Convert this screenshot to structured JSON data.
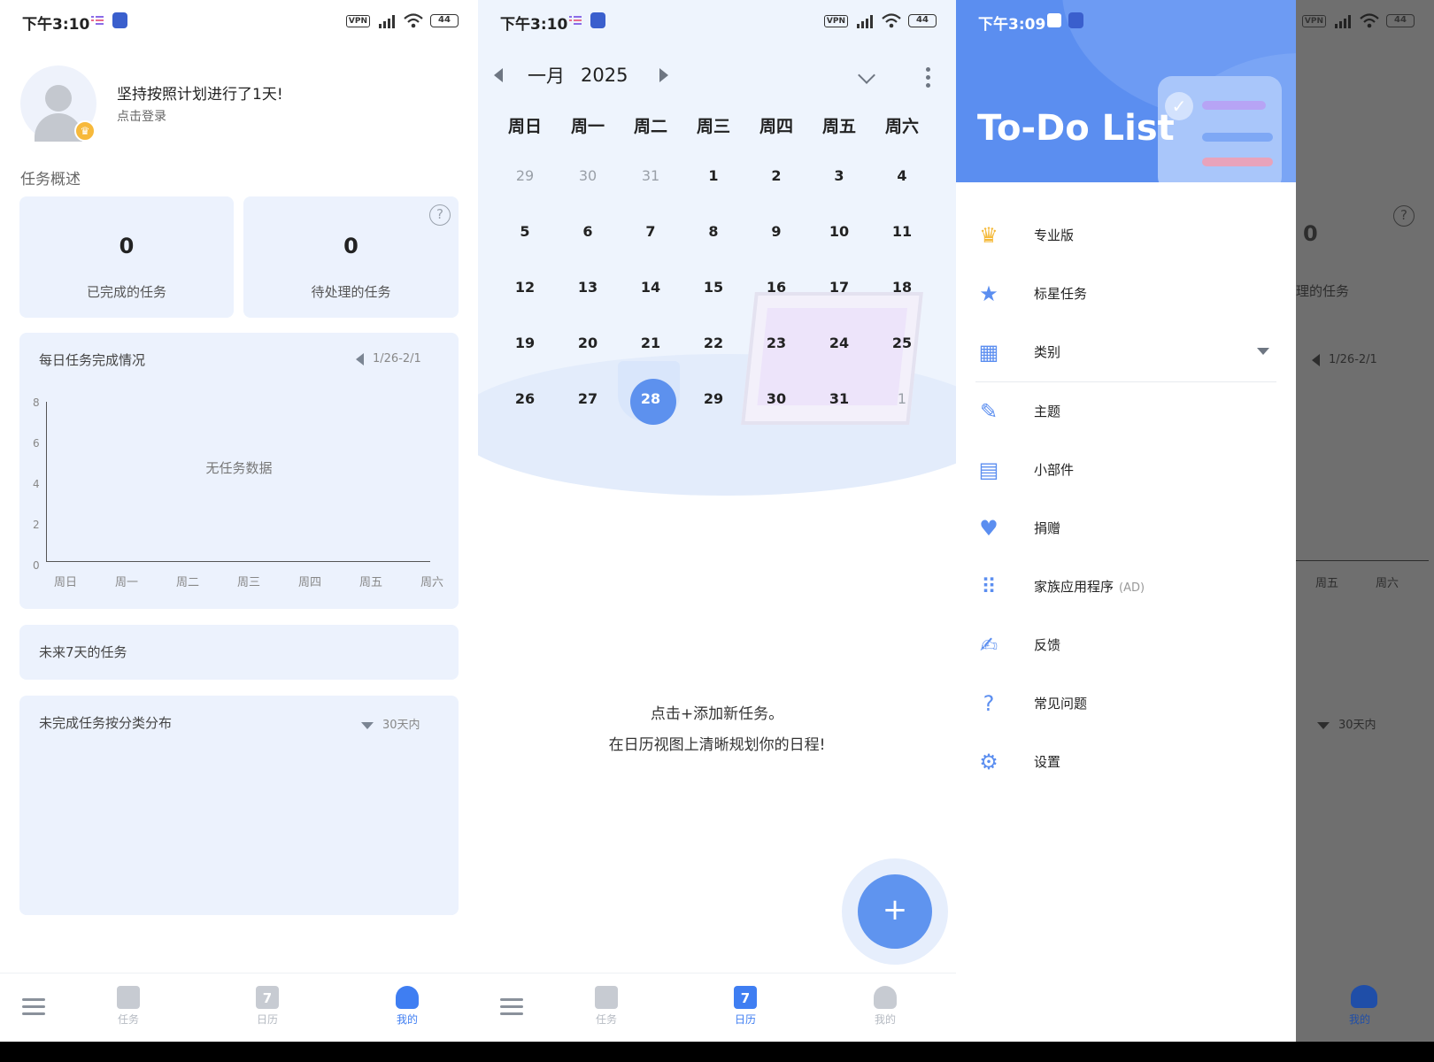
{
  "status_bars": [
    {
      "time": "下午3:10",
      "vpn": "VPN",
      "battery": "44"
    },
    {
      "time": "下午3:10",
      "vpn": "VPN",
      "battery": "44"
    },
    {
      "time": "下午3:09",
      "vpn": "VPN",
      "battery": "44"
    }
  ],
  "profile": {
    "greeting": "坚持按照计划进行了1天!",
    "login": "点击登录",
    "section_title": "任务概述",
    "completed_count": "0",
    "completed_label": "已完成的任务",
    "pending_count": "0",
    "pending_label": "待处理的任务",
    "help_symbol": "?"
  },
  "daily_chart": {
    "title": "每日任务完成情况",
    "range": "1/26-2/1",
    "empty_text": "无任务数据",
    "chart_data": {
      "type": "bar",
      "categories": [
        "周日",
        "周一",
        "周二",
        "周三",
        "周四",
        "周五",
        "周六"
      ],
      "values": [],
      "ylim": [
        0,
        8
      ],
      "yticks": [
        "8",
        "6",
        "4",
        "2",
        "0"
      ]
    }
  },
  "next7": {
    "title": "未来7天的任务"
  },
  "category": {
    "title": "未完成任务按分类分布",
    "range": "30天内"
  },
  "nav": {
    "tasks": "任务",
    "calendar": "日历",
    "mine": "我的",
    "cal_icon_num": "7"
  },
  "calendar": {
    "month": "一月",
    "year": "2025",
    "weekdays": [
      "周日",
      "周一",
      "周二",
      "周三",
      "周四",
      "周五",
      "周六"
    ],
    "weeks": [
      [
        "29",
        "30",
        "31",
        "1",
        "2",
        "3",
        "4"
      ],
      [
        "5",
        "6",
        "7",
        "8",
        "9",
        "10",
        "11"
      ],
      [
        "12",
        "13",
        "14",
        "15",
        "16",
        "17",
        "18"
      ],
      [
        "19",
        "20",
        "21",
        "22",
        "23",
        "24",
        "25"
      ],
      [
        "26",
        "27",
        "28",
        "29",
        "30",
        "31",
        "1"
      ]
    ],
    "today": "28",
    "hint_line1": "点击+添加新任务。",
    "hint_line2": "在日历视图上清晰规划你的日程!",
    "fab_symbol": "+"
  },
  "drawer": {
    "brand": "To-Do List",
    "items": [
      {
        "label": "专业版",
        "icon": "crown-icon",
        "glyph": "♛"
      },
      {
        "label": "标星任务",
        "icon": "star-icon",
        "glyph": "★"
      },
      {
        "label": "类别",
        "icon": "category-icon",
        "glyph": "▦"
      },
      {
        "label": "主题",
        "icon": "brush-icon",
        "glyph": "✎"
      },
      {
        "label": "小部件",
        "icon": "widget-icon",
        "glyph": "▤"
      },
      {
        "label": "捐赠",
        "icon": "heart-icon",
        "glyph": "♥"
      },
      {
        "label": "家族应用程序",
        "icon": "apps-grid-icon",
        "glyph": "⠿",
        "tag": "(AD)"
      },
      {
        "label": "反馈",
        "icon": "feedback-icon",
        "glyph": "✍"
      },
      {
        "label": "常见问题",
        "icon": "question-icon",
        "glyph": "?"
      },
      {
        "label": "设置",
        "icon": "gear-icon",
        "glyph": "⚙"
      }
    ]
  },
  "background_peek": {
    "count": "0",
    "pending_suffix": "理的任务",
    "range": "1/26-2/1",
    "ticks": [
      "周五",
      "周六"
    ],
    "cat_range": "30天内",
    "nav_label": "我的",
    "help_symbol": "?"
  },
  "colors": {
    "accent": "#3f7ef2",
    "card": "#ecf2fd",
    "crown": "#f7b93b"
  }
}
